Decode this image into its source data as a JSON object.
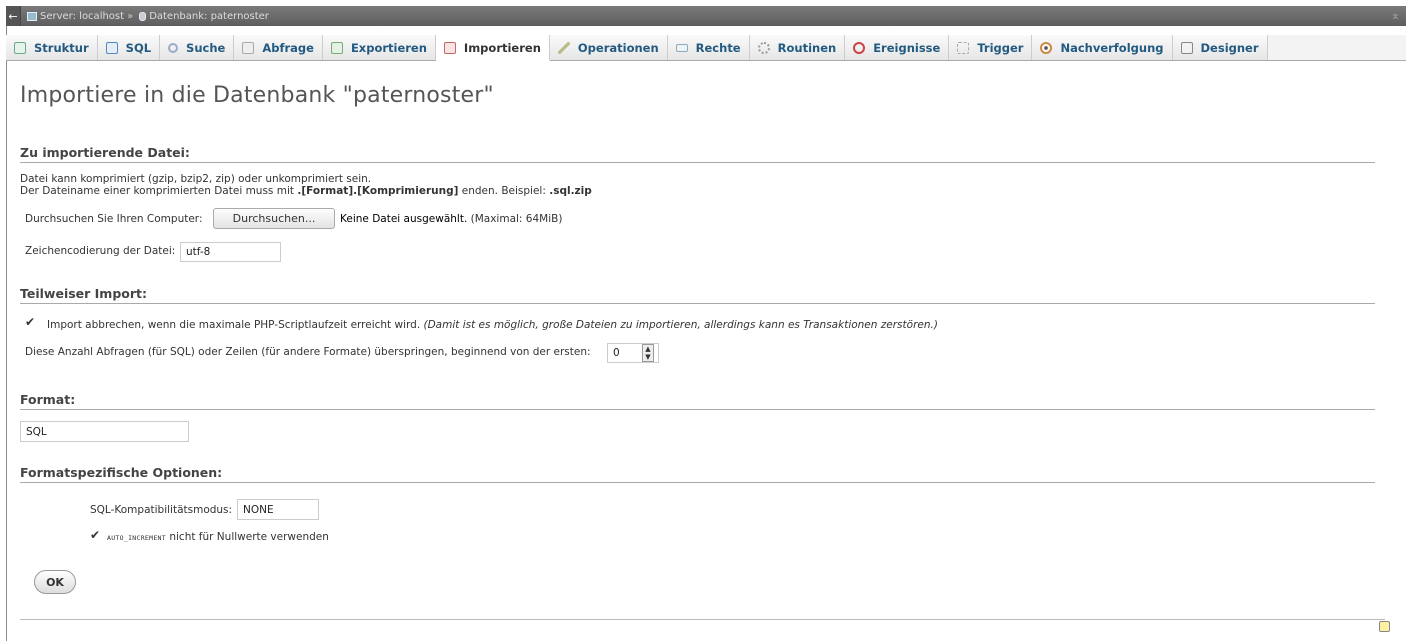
{
  "breadcrumb": {
    "server": "Server: localhost",
    "separator": "»",
    "database": "Datenbank: paternoster"
  },
  "tabs": [
    {
      "label": "Struktur",
      "icon": "structure-icon",
      "color": "#6a8"
    },
    {
      "label": "SQL",
      "icon": "sql-icon",
      "color": "#58b"
    },
    {
      "label": "Suche",
      "icon": "search-icon",
      "color": "#9ac"
    },
    {
      "label": "Abfrage",
      "icon": "query-icon",
      "color": "#aaa"
    },
    {
      "label": "Exportieren",
      "icon": "export-icon",
      "color": "#7a7"
    },
    {
      "label": "Importieren",
      "icon": "import-icon",
      "color": "#c66"
    },
    {
      "label": "Operationen",
      "icon": "wrench-icon",
      "color": "#bb8"
    },
    {
      "label": "Rechte",
      "icon": "privileges-icon",
      "color": "#8ab"
    },
    {
      "label": "Routinen",
      "icon": "routines-icon",
      "color": "#999"
    },
    {
      "label": "Ereignisse",
      "icon": "clock-icon",
      "color": "#c44"
    },
    {
      "label": "Trigger",
      "icon": "trigger-icon",
      "color": "#aaa"
    },
    {
      "label": "Nachverfolgung",
      "icon": "eye-icon",
      "color": "#c84"
    },
    {
      "label": "Designer",
      "icon": "designer-icon",
      "color": "#888"
    }
  ],
  "page": {
    "title": "Importiere in die Datenbank \"paternoster\""
  },
  "file_section": {
    "heading": "Zu importierende Datei:",
    "line1": "Datei kann komprimiert (gzip, bzip2, zip) oder unkomprimiert sein.",
    "line2_pre": "Der Dateiname einer komprimierten Datei muss mit ",
    "line2_bold": ".[Format].[Komprimierung]",
    "line2_mid": " enden. Beispiel: ",
    "line2_example": ".sql.zip",
    "browse_label": "Durchsuchen Sie Ihren Computer:",
    "browse_button": "Durchsuchen...",
    "no_file": "Keine Datei ausgewählt.",
    "max": "(Maximal: 64MiB)",
    "charset_label": "Zeichencodierung der Datei:",
    "charset_value": "utf-8"
  },
  "partial_section": {
    "heading": "Teilweiser Import:",
    "abort_text": "Import abbrechen, wenn die maximale PHP-Scriptlaufzeit erreicht wird.",
    "abort_note": "(Damit ist es möglich, große Dateien zu importieren, allerdings kann es Transaktionen zerstören.)",
    "skip_label": "Diese Anzahl Abfragen (für SQL) oder Zeilen (für andere Formate) überspringen, beginnend von der ersten:",
    "skip_value": "0"
  },
  "format_section": {
    "heading": "Format:",
    "value": "SQL"
  },
  "options_section": {
    "heading": "Formatspezifische Optionen:",
    "compat_label": "SQL-Kompatibilitätsmodus:",
    "compat_value": "NONE",
    "auto_code": "AUTO_INCREMENT",
    "auto_text": "nicht für Nullwerte verwenden"
  },
  "submit": {
    "label": "OK"
  }
}
